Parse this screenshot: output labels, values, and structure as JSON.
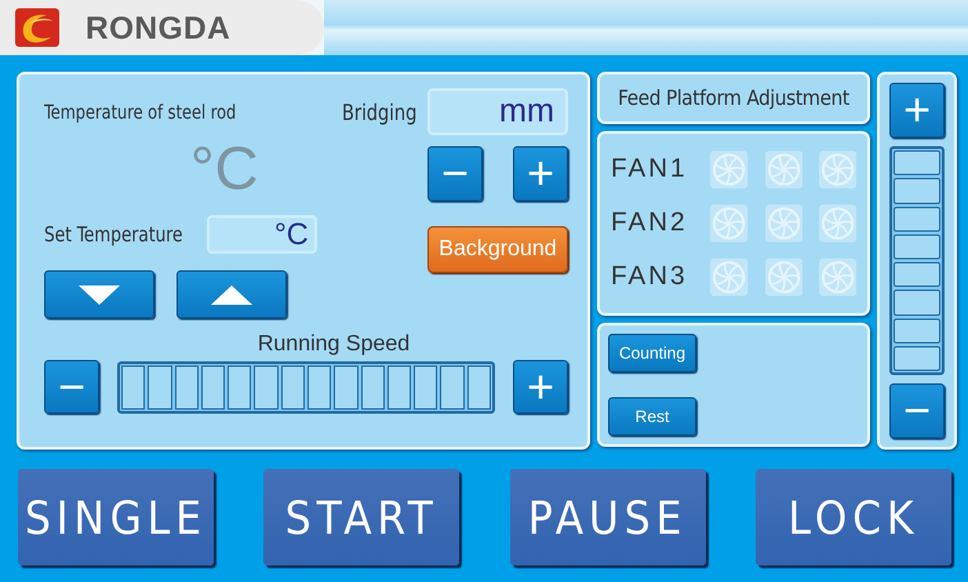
{
  "header": {
    "brand": "RONGDA"
  },
  "left_panel": {
    "steel_rod_label": "Temperature of steel rod",
    "steel_rod_reading": "°C",
    "bridging_label": "Bridging",
    "bridging_value": "mm",
    "bridging_buttons": [
      "−",
      "+"
    ],
    "set_temperature_label": "Set Temperature",
    "set_temperature_value": "°C",
    "background_button": "Background",
    "running_speed": {
      "label": "Running Speed",
      "level": 0,
      "buttons": [
        "−",
        "+"
      ]
    }
  },
  "feed_platform": {
    "label": "Feed Platform Adjustment",
    "level": 0,
    "buttons": [
      "+",
      "−"
    ]
  },
  "fans": [
    {
      "label": "FAN1",
      "units": [
        {
          "on": false
        },
        {
          "on": false
        },
        {
          "on": false
        }
      ]
    },
    {
      "label": "FAN2",
      "units": [
        {
          "on": false
        },
        {
          "on": false
        },
        {
          "on": false
        }
      ]
    },
    {
      "label": "FAN3",
      "units": [
        {
          "on": false
        },
        {
          "on": false
        },
        {
          "on": false
        }
      ]
    }
  ],
  "counter_buttons": [
    "Counting",
    "Rest"
  ],
  "bottom_buttons": [
    "SINGLE",
    "START",
    "PAUSE",
    "LOCK"
  ]
}
